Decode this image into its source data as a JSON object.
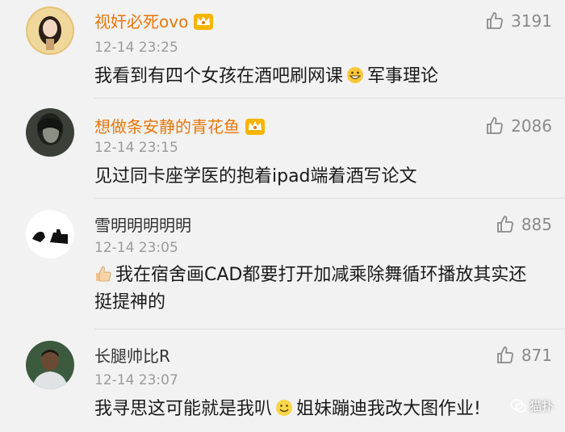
{
  "comments": [
    {
      "username": "视奸必死ovo",
      "vip": true,
      "time": "12-14 23:25",
      "likes": "3191",
      "text_before": "我看到有四个女孩在酒吧刷网课",
      "emoji": "grin-emoji",
      "text_after": "军事理论"
    },
    {
      "username": "想做条安静的青花鱼",
      "vip": true,
      "time": "12-14 23:15",
      "likes": "2086",
      "text": "见过同卡座学医的抱着ipad端着酒写论文"
    },
    {
      "username": "雪明明明明明",
      "vip": false,
      "time": "12-14 23:05",
      "likes": "885",
      "emoji": "thumbs-up-emoji",
      "text": "我在宿舍画CAD都要打开加减乘除舞循环播放其实还挺提神的"
    },
    {
      "username": "长腿帅比R",
      "vip": false,
      "time": "12-14 23:07",
      "likes": "871",
      "text_before": "我寻思这可能就是我叭",
      "emoji": "smile-emoji",
      "text_after": "姐妹蹦迪我改大图作业!"
    }
  ],
  "watermark": "猫扑",
  "colors": {
    "vip_name": "#e8770b",
    "normal_name": "#333333",
    "time": "#9a9a9a",
    "background": "#f2f2f2"
  }
}
